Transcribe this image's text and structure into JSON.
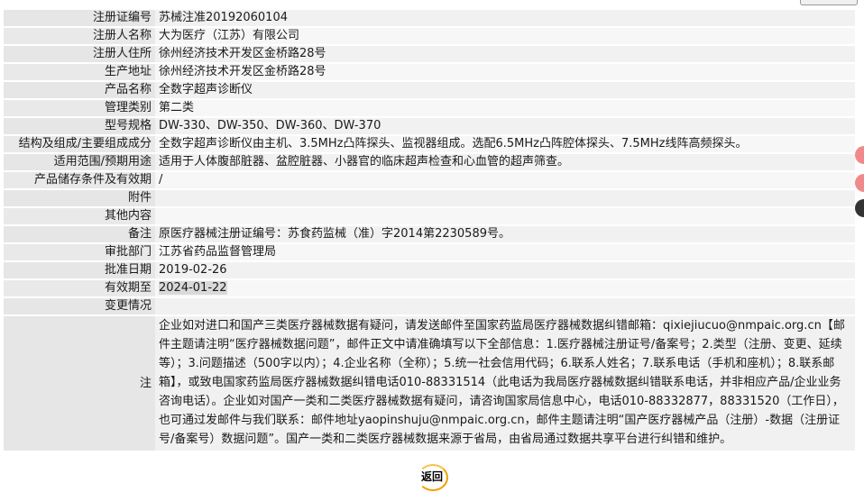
{
  "header": {
    "title_fragment": "国产医疗器械产品（注册）"
  },
  "rows": [
    {
      "label": "注册证编号",
      "value": "苏械注准20192060104"
    },
    {
      "label": "注册人名称",
      "value": "大为医疗（江苏）有限公司"
    },
    {
      "label": "注册人住所",
      "value": "徐州经济技术开发区金桥路28号"
    },
    {
      "label": "生产地址",
      "value": "徐州经济技术开发区金桥路28号"
    },
    {
      "label": "产品名称",
      "value": "全数字超声诊断仪"
    },
    {
      "label": "管理类别",
      "value": "第二类"
    },
    {
      "label": "型号规格",
      "value": "DW-330、DW-350、DW-360、DW-370"
    },
    {
      "label": "结构及组成/主要组成成分",
      "value": "全数字超声诊断仪由主机、3.5MHz凸阵探头、监视器组成。选配6.5MHz凸阵腔体探头、7.5MHz线阵高频探头。"
    },
    {
      "label": "适用范围/预期用途",
      "value": "适用于人体腹部脏器、盆腔脏器、小器官的临床超声检查和心血管的超声筛查。"
    },
    {
      "label": "产品储存条件及有效期",
      "value": "/"
    },
    {
      "label": "附件",
      "value": ""
    },
    {
      "label": "其他内容",
      "value": ""
    },
    {
      "label": "备注",
      "value": "原医疗器械注册证编号：苏食药监械（准）字2014第2230589号。"
    },
    {
      "label": "审批部门",
      "value": "江苏省药品监督管理局"
    },
    {
      "label": "批准日期",
      "value": "2019-02-26"
    },
    {
      "label": "有效期至",
      "value": "2024-01-22"
    },
    {
      "label": "变更情况",
      "value": ""
    }
  ],
  "note": {
    "label": "注",
    "text": "企业如对进口和国产三类医疗器械数据有疑问，请发送邮件至国家药监局医疗器械数据纠错邮箱：qixiejiucuo@nmpaic.org.cn【邮件主题请注明“医疗器械数据问题”，邮件正文中请准确填写以下全部信息：1.医疗器械注册证号/备案号；2.类型（注册、变更、延续等）；3.问题描述（500字以内）；4.企业名称（全称）；5.统一社会信用代码；6.联系人姓名；7.联系电话（手机和座机）；8.联系邮箱】，或致电国家药监局医疗器械数据纠错电话010-88331514（此电话为我局医疗器械数据纠错联系电话，并非相应产品/企业业务咨询电话）。企业如对国产一类和二类医疗器械数据有疑问，请咨询国家局信息中心，电话010-88332877，88331520（工作日），也可通过发邮件与我们联系：邮件地址yaopinshuju@nmpaic.org.cn，邮件主题请注明“国产医疗器械产品（注册）-数据（注册证号/备案号）数据问题”。国产一类和二类医疗器械数据来源于省局，由省局通过数据共享平台进行纠错和维护。"
  },
  "footer": {
    "return_label": "返回"
  }
}
